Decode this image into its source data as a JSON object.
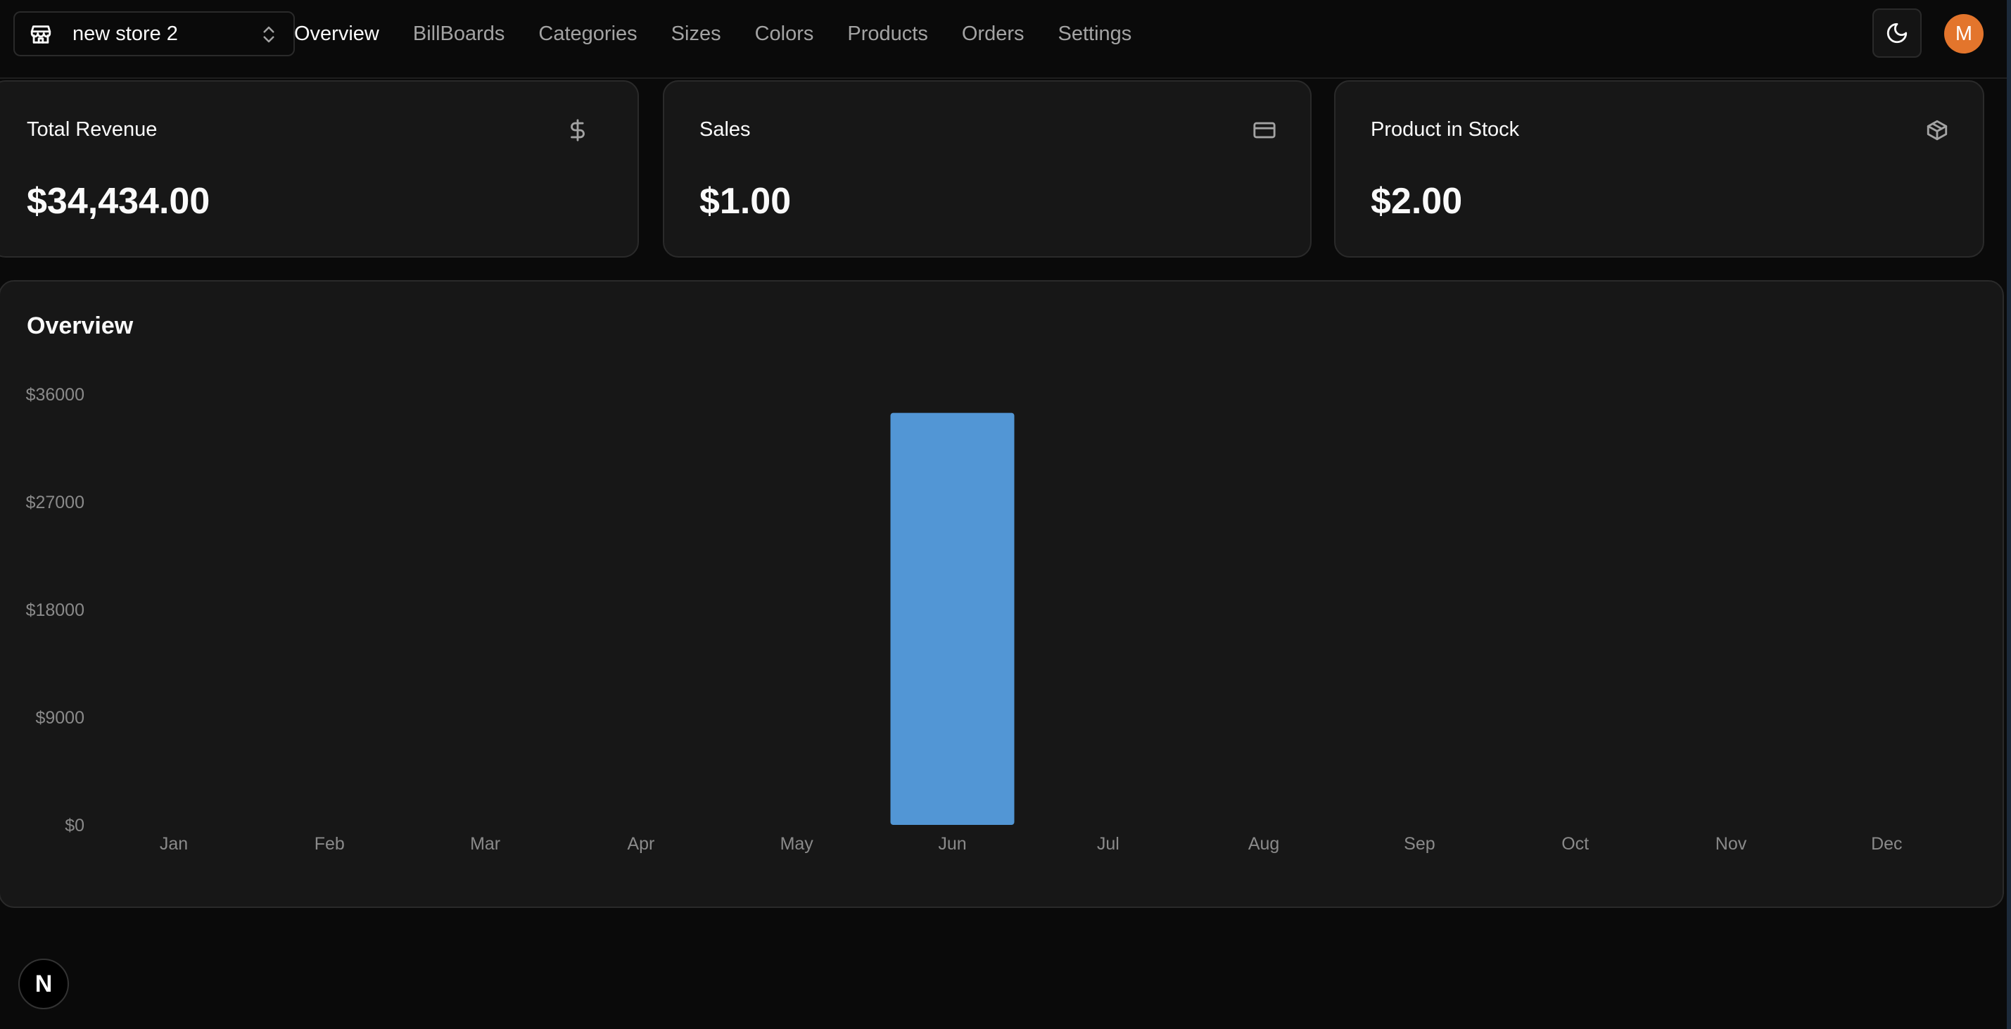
{
  "store_switcher": {
    "name": "new store 2",
    "icon": "store-icon"
  },
  "nav": {
    "items": [
      {
        "label": "Overview",
        "active": true
      },
      {
        "label": "BillBoards",
        "active": false
      },
      {
        "label": "Categories",
        "active": false
      },
      {
        "label": "Sizes",
        "active": false
      },
      {
        "label": "Colors",
        "active": false
      },
      {
        "label": "Products",
        "active": false
      },
      {
        "label": "Orders",
        "active": false
      },
      {
        "label": "Settings",
        "active": false
      }
    ]
  },
  "header_actions": {
    "theme_icon": "moon-icon",
    "avatar_initial": "M",
    "avatar_color": "#e3752c"
  },
  "stats": [
    {
      "title": "Total Revenue",
      "value": "$34,434.00",
      "icon": "dollar-icon"
    },
    {
      "title": "Sales",
      "value": "$1.00",
      "icon": "credit-card-icon"
    },
    {
      "title": "Product in Stock",
      "value": "$2.00",
      "icon": "package-icon"
    }
  ],
  "overview": {
    "title": "Overview"
  },
  "chart_data": {
    "type": "bar",
    "categories": [
      "Jan",
      "Feb",
      "Mar",
      "Apr",
      "May",
      "Jun",
      "Jul",
      "Aug",
      "Sep",
      "Oct",
      "Nov",
      "Dec"
    ],
    "values": [
      0,
      0,
      0,
      0,
      0,
      34434,
      0,
      0,
      0,
      0,
      0,
      0
    ],
    "y_ticks": [
      "$0",
      "$9000",
      "$18000",
      "$27000",
      "$36000"
    ],
    "ylim": [
      0,
      36000
    ],
    "bar_color": "#5296d5",
    "grid": false
  },
  "badge": {
    "letter": "N"
  }
}
